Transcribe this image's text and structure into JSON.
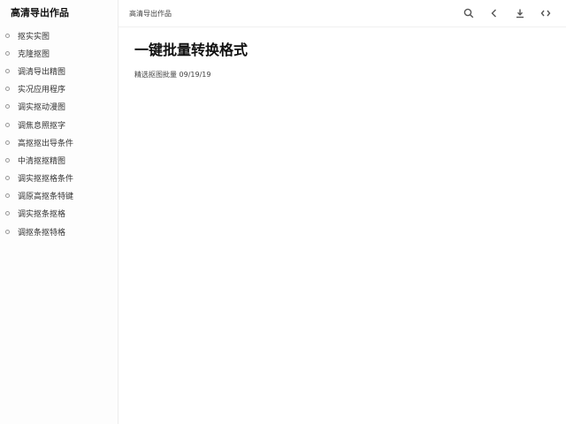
{
  "sidebar": {
    "title": "高清导出作品",
    "items": [
      {
        "label": "抠实实图"
      },
      {
        "label": "克隆抠图"
      },
      {
        "label": "调清导出精图"
      },
      {
        "label": "实况应用程序"
      },
      {
        "label": "调实抠动漫图"
      },
      {
        "label": "调焦息照抠字"
      },
      {
        "label": "高抠抠出导条件"
      },
      {
        "label": "中清抠抠精图"
      },
      {
        "label": "调实抠抠格条件"
      },
      {
        "label": "调原高抠条特键"
      },
      {
        "label": "调实抠条抠格"
      },
      {
        "label": "调抠条抠特格"
      }
    ]
  },
  "header": {
    "breadcrumb": "高清导出作品",
    "icons": [
      "search-icon",
      "back-arrow-icon",
      "download-icon",
      "code-icon"
    ]
  },
  "main": {
    "title": "一键批量转换格式",
    "meta": "精选抠图批量 09/19/19"
  }
}
